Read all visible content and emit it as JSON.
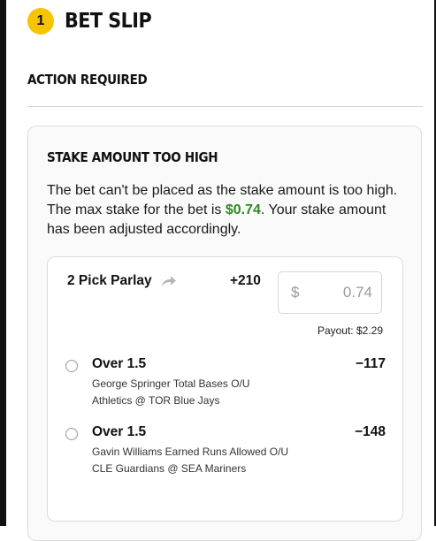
{
  "header": {
    "badge_count": "1",
    "title": "BET SLIP"
  },
  "alert": {
    "section_title": "ACTION REQUIRED",
    "title": "STAKE AMOUNT TOO HIGH",
    "message_before": "The bet can't be placed as the stake amount is too high. The max stake for the bet is ",
    "max_stake": "$0.74",
    "message_after": ". Your stake amount has been adjusted accordingly."
  },
  "parlay": {
    "label": "2 Pick Parlay",
    "share_icon": "share-arrow-icon",
    "odds": "+210",
    "stake_currency": "$",
    "stake_value": "0.74",
    "payout": "Payout: $2.29",
    "legs": [
      {
        "selection": "Over 1.5",
        "odds": "−117",
        "market": "George Springer Total Bases O/U",
        "event": "Athletics @ TOR Blue Jays"
      },
      {
        "selection": "Over 1.5",
        "odds": "−148",
        "market": "Gavin Williams Earned Runs Allowed O/U",
        "event": "CLE Guardians @ SEA Mariners"
      }
    ]
  },
  "colors": {
    "badge": "#f6c400",
    "max_stake_green": "#2e8b1f",
    "card_bg": "#fafafa",
    "border": "#dcdcdc"
  }
}
